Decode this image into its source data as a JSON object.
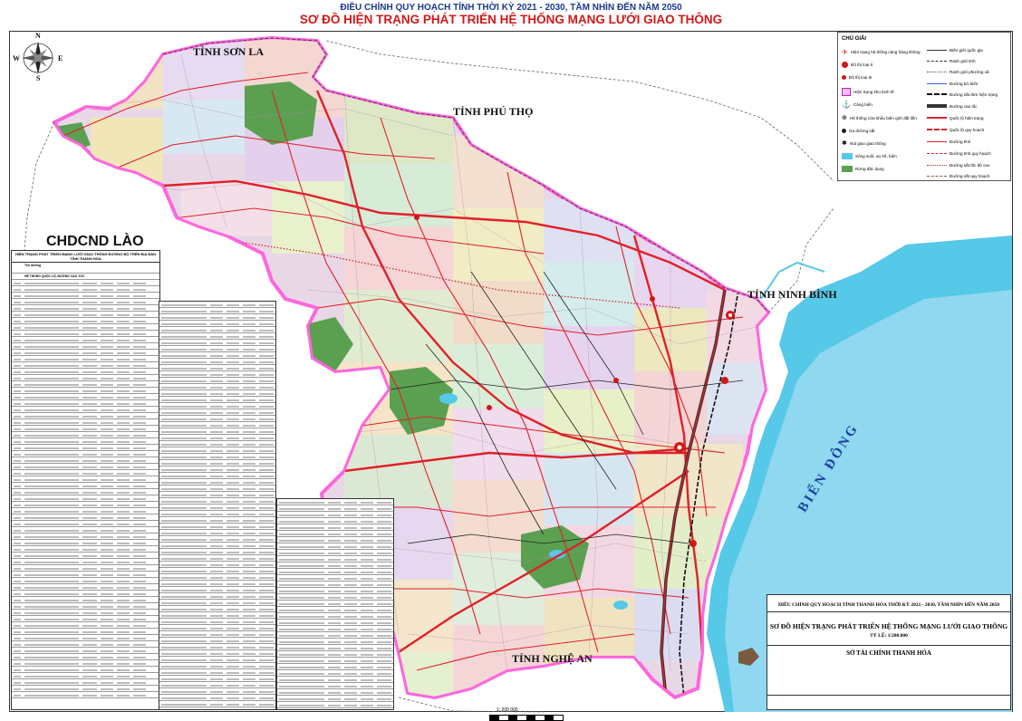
{
  "header": {
    "subtitle": "ĐIỀU CHỈNH QUY HOẠCH TỈNH THỜI KỲ 2021 - 2030, TẦM NHÌN ĐẾN NĂM 2050",
    "title": "SƠ ĐỒ HIỆN TRẠNG PHÁT TRIỂN HỆ THỐNG MẠNG LƯỚI GIAO THÔNG"
  },
  "compass": {
    "n": "N",
    "s": "S",
    "e": "E",
    "w": "W"
  },
  "regions": {
    "son_la": "TỈNH SƠN LA",
    "phu_tho": "TỈNH PHÚ THỌ",
    "ninh_binh": "TỈNH NINH BÌNH",
    "lao": "CHDCND LÀO",
    "nghe_an": "TỈNH NGHỆ AN",
    "sea": "BIỂN ĐÔNG"
  },
  "legend": {
    "title": "CHÚ GIẢI",
    "left_items": [
      {
        "label": "Hiện trạng hệ thống cảng hàng không",
        "icon": "airport-icon",
        "color": "#e0202a"
      },
      {
        "label": "Đô thị loại II",
        "icon": "city-class-2-icon",
        "color": "#d01818"
      },
      {
        "label": "Đô thị loại III",
        "icon": "city-class-3-icon",
        "color": "#d01818"
      },
      {
        "label": "Hiện trạng khu kinh tế",
        "icon": "economic-zone-icon",
        "color": "#c020c0"
      },
      {
        "label": "Cảng biển",
        "icon": "seaport-icon",
        "color": "#2050c0"
      },
      {
        "label": "Hệ thống cửa khẩu biên giới đất liền",
        "icon": "border-gate-icon",
        "color": "#333333"
      },
      {
        "label": "Ga đường sắt",
        "icon": "rail-station-icon",
        "color": "#222222"
      },
      {
        "label": "Nút giao giao thông",
        "icon": "interchange-icon",
        "color": "#333333"
      },
      {
        "label": "Sông suối, ao hồ, biển",
        "icon": "water-swatch-icon",
        "color": "#56c8e8"
      },
      {
        "label": "Rừng đặc dụng",
        "icon": "forest-swatch-icon",
        "color": "#5aa050"
      }
    ],
    "right_items": [
      {
        "label": "Biên giới quốc gia",
        "style": "border-line"
      },
      {
        "label": "Ranh giới tỉnh",
        "style": "dash-line"
      },
      {
        "label": "Ranh giới phường xã",
        "style": "thin-dash"
      },
      {
        "label": "Đường bờ biển",
        "style": "coast-line"
      },
      {
        "label": "Đường sắt đơn hiện trạng",
        "style": "rail-line"
      },
      {
        "label": "Đường cao tốc",
        "style": "expressway"
      },
      {
        "label": "Quốc lộ hiện trạng",
        "style": "national-road"
      },
      {
        "label": "Quốc lộ quy hoạch",
        "style": "planned-national"
      },
      {
        "label": "Đường tỉnh",
        "style": "provincial-road"
      },
      {
        "label": "Đường tỉnh quy hoạch",
        "style": "planned-provincial"
      },
      {
        "label": "Đường sắt tốc độ cao",
        "style": "hsr"
      },
      {
        "label": "Đường sắt quy hoạch",
        "style": "planned-rail"
      }
    ]
  },
  "table_left": {
    "title": "HIỆN TRẠNG PHÁT TRIỂN MẠNG LƯỚI GIAO THÔNG ĐƯỜNG BỘ TRÊN ĐỊA BÀN TỈNH THANH HÓA",
    "col_name": "Tên đường",
    "section_a": "HỆ THỐNG QUỐC LỘ, ĐƯỜNG CAO TỐC",
    "section_b": "ĐƯỜNG TỈNH"
  },
  "title_block": {
    "line1": "ĐIỀU CHỈNH QUY HOẠCH TỈNH THANH HÓA THỜI KỲ 2021 - 2030, TẦM NHÌN ĐẾN NĂM 2050",
    "line2": "SƠ ĐỒ HIỆN TRẠNG PHÁT TRIỂN HỆ THỐNG MẠNG LƯỚI GIAO THÔNG",
    "line3": "TỶ LỆ: 1/200.000",
    "line4": "SỞ TÀI CHÍNH THANH HÓA"
  },
  "scale": {
    "label": "1: 200 000"
  },
  "colors": {
    "title_red": "#d01818",
    "title_blue": "#1a3a8c",
    "province_border": "#ff66dd",
    "sea": "#56c8e8",
    "forest": "#5aa050",
    "road_red": "#e0202a",
    "rail": "#111111"
  }
}
